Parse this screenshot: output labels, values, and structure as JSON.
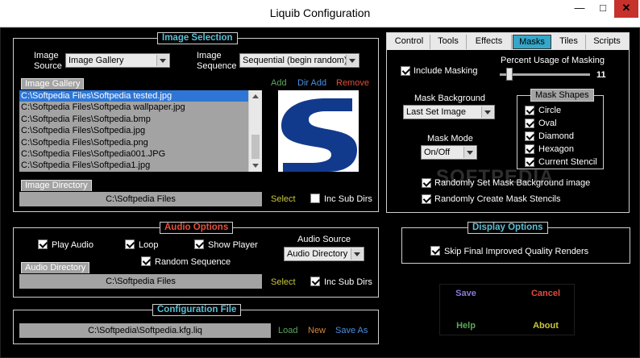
{
  "window": {
    "title": "Liquib Configuration"
  },
  "titlebar": {
    "minimize": "—",
    "maximize": "□",
    "close": "✕"
  },
  "image_selection": {
    "legend": "Image Selection",
    "image_source_label": "Image\nSource",
    "image_source_value": "Image Gallery",
    "image_sequence_label": "Image\nSequence",
    "image_sequence_value": "Sequential (begin random)",
    "gallery_tab": "Image Gallery",
    "actions": {
      "add": "Add",
      "dir_add": "Dir Add",
      "remove": "Remove"
    },
    "files": [
      "C:\\Softpedia Files\\Softpedia tested.jpg",
      "C:\\Softpedia Files\\Softpedia wallpaper.jpg",
      "C:\\Softpedia Files\\Softpedia.bmp",
      "C:\\Softpedia Files\\Softpedia.jpg",
      "C:\\Softpedia Files\\Softpedia.png",
      "C:\\Softpedia Files\\Softpedia001.JPG",
      "C:\\Softpedia Files\\Softpedia1.jpg"
    ],
    "directory_tab": "Image Directory",
    "directory_value": "C:\\Softpedia Files",
    "select": "Select",
    "inc_sub_dirs": "Inc Sub Dirs"
  },
  "tabs": [
    {
      "label": "Control",
      "active": false
    },
    {
      "label": "Tools",
      "active": false
    },
    {
      "label": "Effects",
      "active": false
    },
    {
      "label": "Masks",
      "active": true
    },
    {
      "label": "Tiles",
      "active": false
    },
    {
      "label": "Scripts",
      "active": false
    }
  ],
  "masks": {
    "include_masking": "Include Masking",
    "percent_label": "Percent Usage of Masking",
    "percent_value": "11",
    "percent_fraction": 0.11,
    "background_label": "Mask Background",
    "background_value": "Last Set Image",
    "mode_label": "Mask Mode",
    "mode_value": "On/Off",
    "shapes_legend": "Mask Shapes",
    "shapes": [
      "Circle",
      "Oval",
      "Diamond",
      "Hexagon",
      "Current Stencil"
    ],
    "random_background": "Randomly Set Mask Background image",
    "random_stencils": "Randomly Create Mask Stencils"
  },
  "audio": {
    "legend": "Audio Options",
    "play_audio": "Play Audio",
    "loop": "Loop",
    "show_player": "Show Player",
    "random_sequence": "Random Sequence",
    "source_label": "Audio Source",
    "source_value": "Audio Directory",
    "directory_tab": "Audio Directory",
    "directory_value": "C:\\Softpedia Files",
    "select": "Select",
    "inc_sub_dirs": "Inc Sub Dirs"
  },
  "display": {
    "legend": "Display Options",
    "skip_final": "Skip Final Improved Quality Renders"
  },
  "config": {
    "legend": "Configuration File",
    "path": "C:\\Softpedia\\Softpedia.kfg.liq",
    "load": "Load",
    "new": "New",
    "save_as": "Save As"
  },
  "buttons": {
    "save": "Save",
    "cancel": "Cancel",
    "help": "Help",
    "about": "About"
  },
  "watermark": "SOFTPEDIA",
  "colors": {
    "accent": "#35a7c9",
    "selection": "#2e76d6",
    "field": "#a3a3a3"
  }
}
